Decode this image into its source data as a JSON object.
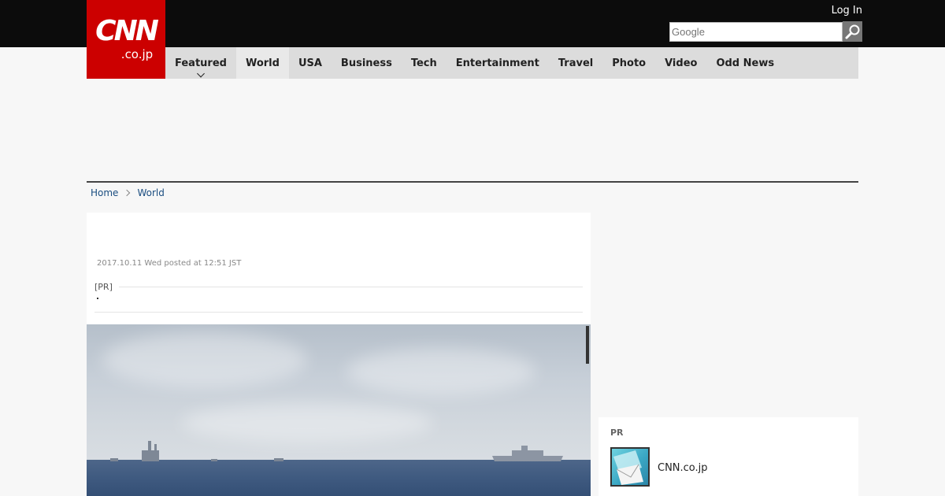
{
  "header": {
    "logo_main": "CNN",
    "logo_sub": ".co.jp",
    "login_label": "Log In",
    "search_placeholder": "Google",
    "nav": [
      {
        "label": "Featured"
      },
      {
        "label": "World"
      },
      {
        "label": "USA"
      },
      {
        "label": "Business"
      },
      {
        "label": "Tech"
      },
      {
        "label": "Entertainment"
      },
      {
        "label": "Travel"
      },
      {
        "label": "Photo"
      },
      {
        "label": "Video"
      },
      {
        "label": "Odd News"
      }
    ],
    "active_nav": "World"
  },
  "breadcrumb": {
    "home": "Home",
    "current": "World"
  },
  "article": {
    "timestamp": "2017.10.11 Wed posted at 12:51 JST",
    "pr_label": "[PR]"
  },
  "sidebar": {
    "pr_heading": "PR",
    "item_title": "CNN.co.jp"
  },
  "colors": {
    "brand_red": "#cc0000",
    "header_black": "#0c0c0c",
    "nav_gray": "#dcdcdc",
    "link_blue": "#1a4d80"
  },
  "icons": [
    "search-icon",
    "chevron-down-icon",
    "chevron-right-icon"
  ]
}
